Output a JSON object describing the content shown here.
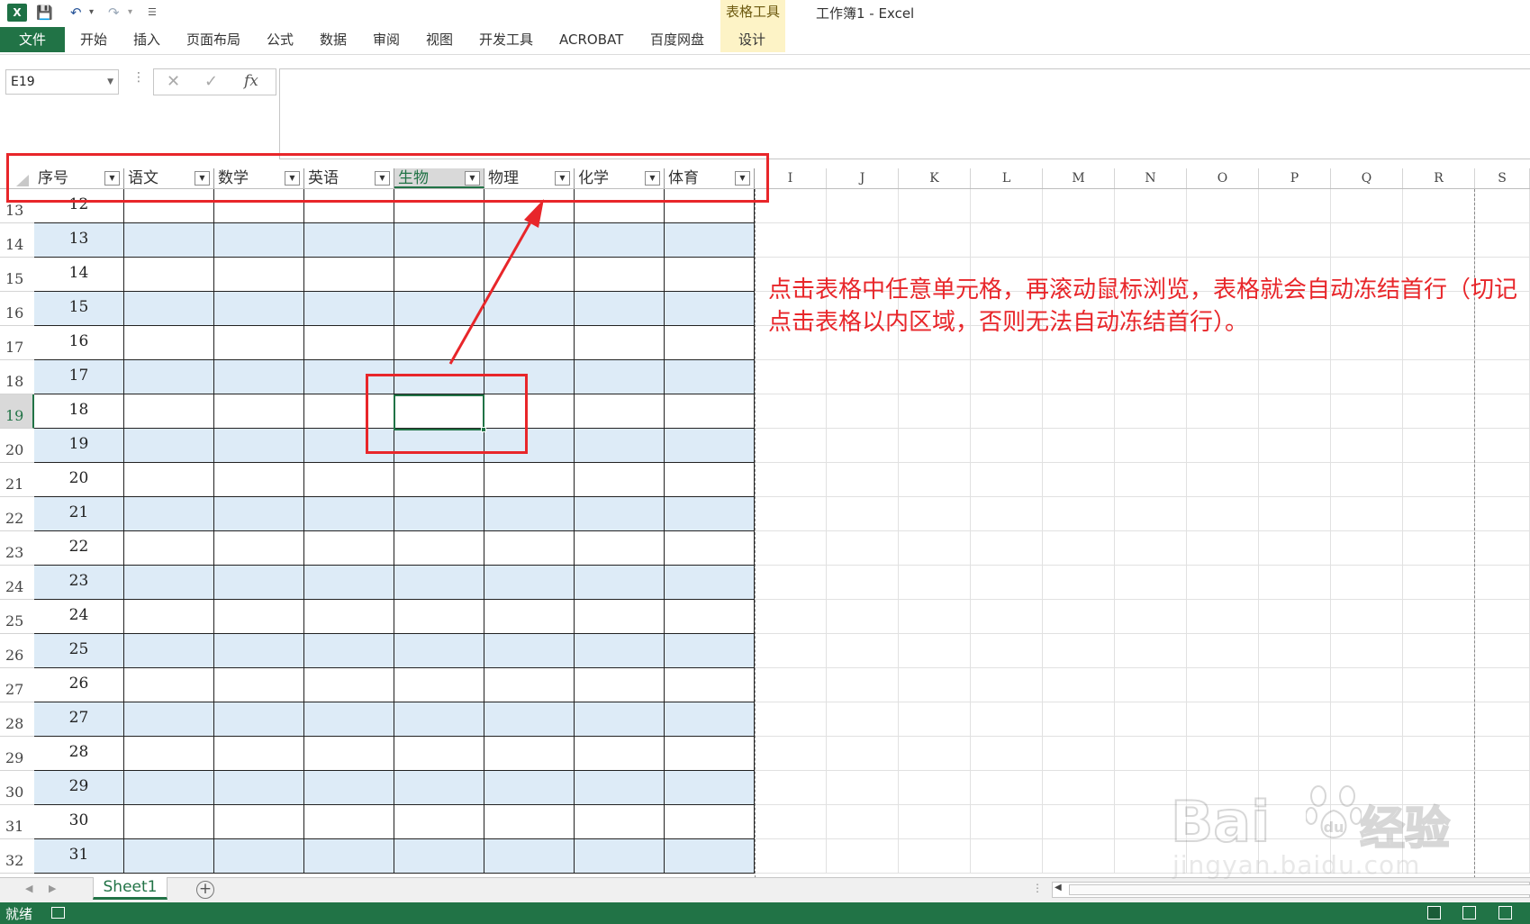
{
  "title_bar": {
    "app_icon": "excel-logo-icon",
    "window_title": "工作簿1 - Excel",
    "contextual_group_label": "表格工具",
    "quick_access": [
      "save-icon",
      "undo-icon",
      "redo-icon",
      "customize-qat-icon"
    ]
  },
  "ribbon": {
    "file_tab": "文件",
    "tabs": [
      "开始",
      "插入",
      "页面布局",
      "公式",
      "数据",
      "审阅",
      "视图",
      "开发工具",
      "ACROBAT",
      "百度网盘",
      "设计"
    ]
  },
  "formula_bar": {
    "name_box": "E19",
    "formula": ""
  },
  "table": {
    "headers": [
      "序号",
      "语文",
      "数学",
      "英语",
      "生物",
      "物理",
      "化学",
      "体育"
    ],
    "selected_header": "生物"
  },
  "columns_outside_table": [
    "I",
    "J",
    "K",
    "L",
    "M",
    "N",
    "O",
    "P",
    "Q",
    "R",
    "S"
  ],
  "rows": [
    {
      "row": "13",
      "seq": "12"
    },
    {
      "row": "14",
      "seq": "13"
    },
    {
      "row": "15",
      "seq": "14"
    },
    {
      "row": "16",
      "seq": "15"
    },
    {
      "row": "17",
      "seq": "16"
    },
    {
      "row": "18",
      "seq": "17"
    },
    {
      "row": "19",
      "seq": "18"
    },
    {
      "row": "20",
      "seq": "19"
    },
    {
      "row": "21",
      "seq": "20"
    },
    {
      "row": "22",
      "seq": "21"
    },
    {
      "row": "23",
      "seq": "22"
    },
    {
      "row": "24",
      "seq": "23"
    },
    {
      "row": "25",
      "seq": "24"
    },
    {
      "row": "26",
      "seq": "25"
    },
    {
      "row": "27",
      "seq": "26"
    },
    {
      "row": "28",
      "seq": "27"
    },
    {
      "row": "29",
      "seq": "28"
    },
    {
      "row": "30",
      "seq": "29"
    },
    {
      "row": "31",
      "seq": "30"
    },
    {
      "row": "32",
      "seq": "31"
    }
  ],
  "selected_row": "19",
  "annotation": {
    "text": "点击表格中任意单元格，再滚动鼠标浏览，表格就会自动冻结首行（切记点击表格以内区域，否则无法自动冻结首行）。",
    "color": "#e8262a"
  },
  "sheet_tabs": [
    "Sheet1"
  ],
  "status_bar": {
    "status": "就绪"
  },
  "colors": {
    "excel_green": "#217346",
    "band_blue": "#ddebf7",
    "annotation_red": "#e8262a"
  },
  "watermark": {
    "brand": "Bai",
    "brand_suffix": "du",
    "cn": "经验",
    "url": "jingyan.baidu.com"
  }
}
